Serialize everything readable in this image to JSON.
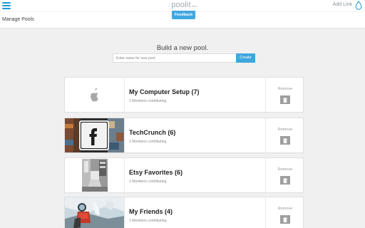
{
  "header": {
    "logo_text": "poolit",
    "logo_suffix": "beta",
    "add_link_label": "Add Link"
  },
  "feedback_label": "Feedback",
  "page_title": "Manage Pools",
  "build": {
    "title": "Build a new pool.",
    "input_placeholder": "Enter name for new pool.",
    "create_label": "Create"
  },
  "pools": [
    {
      "name": "My Computer Setup (7)",
      "members": "1 Members contributing.",
      "remove_label": "Remove",
      "thumb": "apple-icon"
    },
    {
      "name": "TechCrunch (6)",
      "members": "1 Members contributing.",
      "remove_label": "Remove",
      "thumb": "facebook-icon-photo"
    },
    {
      "name": "Etsy Favorites (6)",
      "members": "1 Members contributing.",
      "remove_label": "Remove",
      "thumb": "interior-photo"
    },
    {
      "name": "My Friends (4)",
      "members": "1 Members contributing.",
      "remove_label": "Remove",
      "thumb": "skier-photo"
    }
  ],
  "colors": {
    "accent": "#3fa7e0",
    "background": "#f0f0f0",
    "trash_button": "#9e9e9e"
  }
}
